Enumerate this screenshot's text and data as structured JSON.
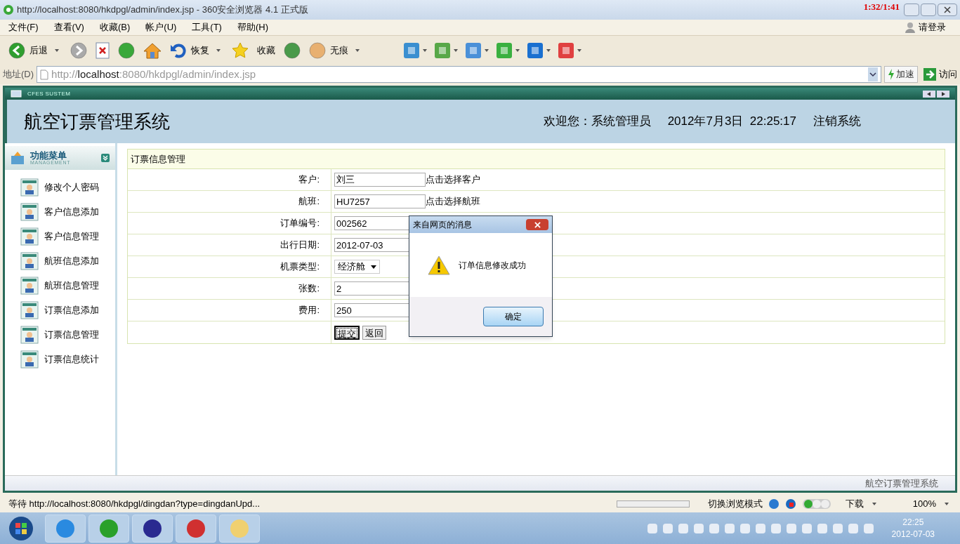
{
  "browser": {
    "title": "http://localhost:8080/hkdpgl/admin/index.jsp - 360安全浏览器 4.1 正式版",
    "recorder_overlay": "1:32/1:41",
    "menu": [
      "文件(F)",
      "查看(V)",
      "收藏(B)",
      "帐户(U)",
      "工具(T)",
      "帮助(H)"
    ],
    "login": "请登录",
    "toolbar": [
      {
        "label": "后退",
        "dropdown": true
      },
      {
        "dropdown": false
      },
      {
        "dropdown": false
      },
      {
        "dropdown": false
      },
      {
        "dropdown": false
      },
      {
        "label": "恢复",
        "dropdown": true
      },
      {
        "dropdown": false
      },
      {
        "label": "收藏",
        "dropdown": false
      },
      {
        "dropdown": false
      },
      {
        "label": "无痕",
        "dropdown": true
      }
    ],
    "extensions": [
      {
        "dropdown": true
      },
      {
        "dropdown": true
      },
      {
        "dropdown": true
      },
      {
        "dropdown": true
      },
      {
        "dropdown": true
      },
      {
        "dropdown": true
      }
    ],
    "address_label": "地址(D)",
    "url_prefix": "http://",
    "url_host": "localhost",
    "url_rest": ":8080/hkdpgl/admin/index.jsp",
    "speed_button": "加速",
    "go_button": "访问"
  },
  "app": {
    "frame_title": "CFES SUSTEM",
    "system_title": "航空订票管理系统",
    "welcome": "欢迎您：系统管理员",
    "datetime": "2012年7月3日  22:25:17",
    "logout": "注销系统",
    "sidebar": {
      "title": "功能菜单",
      "subtitle": "MANAGEMENT",
      "items": [
        "修改个人密码",
        "客户信息添加",
        "客户信息管理",
        "航班信息添加",
        "航班信息管理",
        "订票信息添加",
        "订票信息管理",
        "订票信息统计"
      ]
    },
    "panel": {
      "title": "订票信息管理",
      "rows": [
        {
          "kind": "text",
          "label": "客户:",
          "value": "刘三",
          "link": "点击选择客户"
        },
        {
          "kind": "text",
          "label": "航班:",
          "value": "HU7257",
          "link": "点击选择航班"
        },
        {
          "kind": "text",
          "label": "订单编号:",
          "value": "002562"
        },
        {
          "kind": "text",
          "label": "出行日期:",
          "value": "2012-07-03"
        },
        {
          "kind": "select",
          "label": "机票类型:",
          "value": "经济舱"
        },
        {
          "kind": "text",
          "label": "张数:",
          "value": "2"
        },
        {
          "kind": "text",
          "label": "费用:",
          "value": "250"
        },
        {
          "kind": "buttons",
          "buttons": [
            {
              "label": "提交",
              "focused": true
            },
            {
              "label": "返回",
              "focused": false
            }
          ]
        }
      ]
    },
    "footer": "航空订票管理系统"
  },
  "dialog": {
    "title": "来自网页的消息",
    "message": "订单信息修改成功",
    "ok": "确定"
  },
  "status_bar": {
    "text": "等待 http://localhost:8080/hkdpgl/dingdan?type=dingdanUpd...",
    "mode": "切换浏览模式",
    "download": "下载",
    "zoom": "100%",
    "progress": {
      "level": 0
    }
  },
  "taskbar": {
    "time": "22:25",
    "date": "2012-07-03"
  }
}
